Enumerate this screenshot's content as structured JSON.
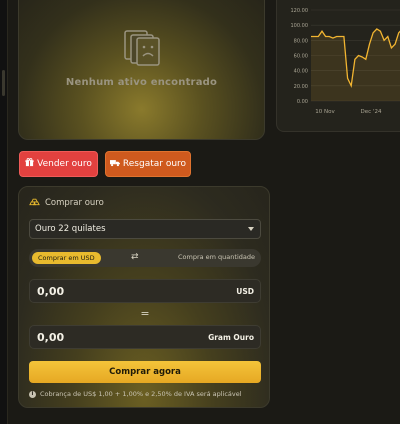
{
  "empty_state": {
    "message": "Nenhum ativo encontrado",
    "icon": "sad-document-icon"
  },
  "chart_data": {
    "type": "line",
    "y_ticks": [
      "120.00",
      "100.00",
      "80.00",
      "60.00",
      "40.00",
      "20.00",
      "0.00"
    ],
    "x_ticks": [
      "10 Nov",
      "Dec '24"
    ],
    "ylim": [
      0,
      120
    ],
    "color": "#f2b531",
    "values": [
      85,
      85,
      85,
      92,
      85,
      85,
      83,
      85,
      85,
      85,
      30,
      20,
      55,
      60,
      58,
      55,
      75,
      90,
      95,
      92,
      80,
      85,
      70,
      75,
      90,
      95,
      80,
      92,
      85,
      90
    ]
  },
  "actions": {
    "sell_label": "Vender ouro",
    "redeem_label": "Resgatar ouro"
  },
  "buy": {
    "title": "Comprar ouro",
    "product_selected": "Ouro 22 quilates",
    "mode_usd": "Comprar em USD",
    "mode_quantity": "Compra em quantidade",
    "amount_value": "0,00",
    "amount_unit": "USD",
    "equals": "=",
    "gram_value": "0,00",
    "gram_unit": "Gram Ouro",
    "submit_label": "Comprar agora",
    "note": "Cobrança de US$ 1,00 + 1,00% e 2,50% de IVA será aplicável"
  },
  "colors": {
    "accent": "#f2b531",
    "sell": "#e2413f",
    "redeem": "#cf5a1e"
  }
}
